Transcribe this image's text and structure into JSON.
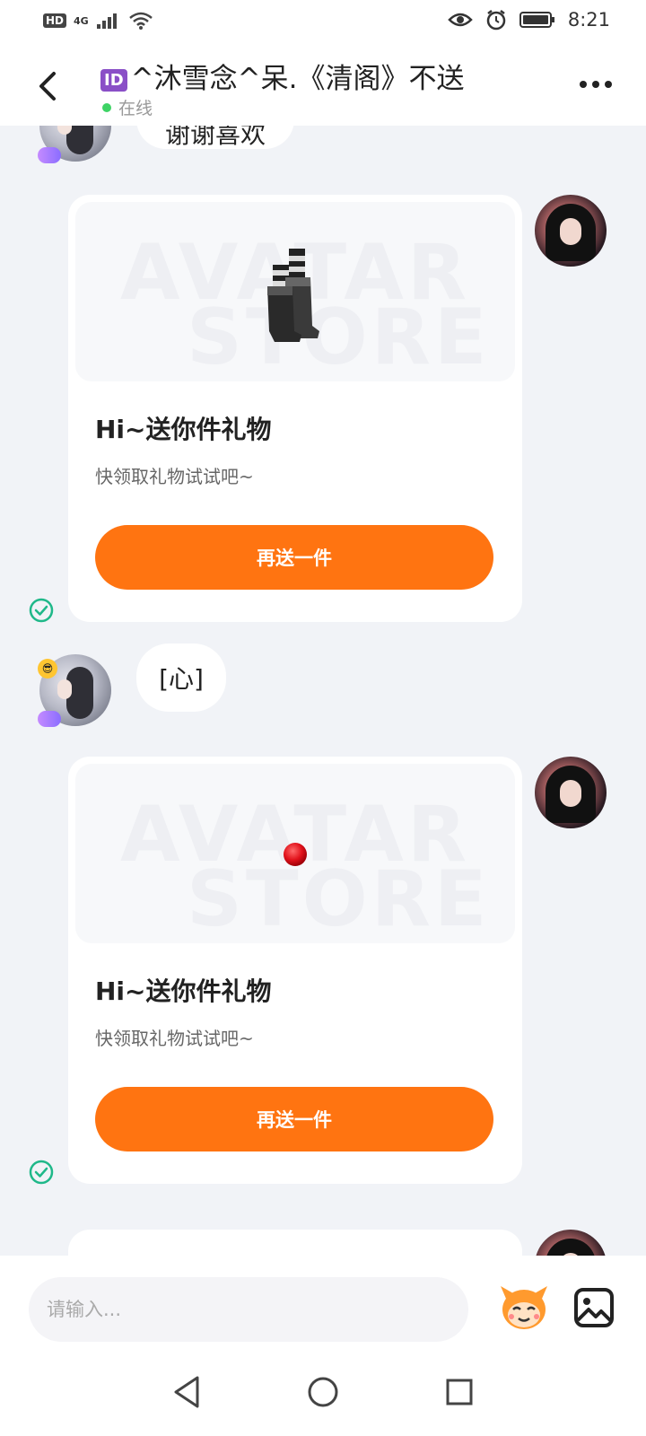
{
  "status_bar": {
    "hd": "HD",
    "network": "4G",
    "time": "8:21",
    "icons": [
      "hd-icon",
      "signal-icon",
      "wifi-icon",
      "eye-icon",
      "alarm-icon",
      "battery-icon"
    ]
  },
  "header": {
    "id_tag": "ID",
    "title": "^沐雪念^呆.《清阁》不送",
    "status": "在线",
    "colors": {
      "online": "#3ed365",
      "id_tag": "#8a4fc7"
    }
  },
  "messages": [
    {
      "type": "text",
      "sender": "other",
      "text": "谢谢喜欢"
    },
    {
      "type": "gift",
      "sender": "self",
      "watermark": [
        "AVATAR",
        "STORE"
      ],
      "item": "boots",
      "title": "Hi~送你件礼物",
      "subtitle": "快领取礼物试试吧~",
      "button": "再送一件",
      "read": true
    },
    {
      "type": "text",
      "sender": "other",
      "text": "[心]"
    },
    {
      "type": "gift",
      "sender": "self",
      "watermark": [
        "AVATAR",
        "STORE"
      ],
      "item": "red-nose",
      "title": "Hi~送你件礼物",
      "subtitle": "快领取礼物试试吧~",
      "button": "再送一件",
      "read": true
    }
  ],
  "input": {
    "placeholder": "请输入..."
  },
  "colors": {
    "accent": "#ff7411",
    "check": "#1fb889",
    "background": "#f1f3f7"
  }
}
